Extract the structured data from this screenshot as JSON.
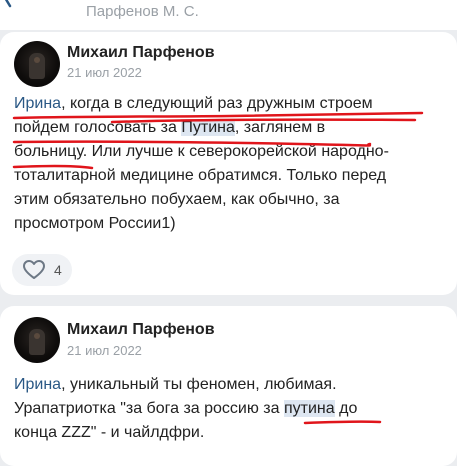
{
  "topbar": {
    "title": "Парфенов М. С."
  },
  "comments": [
    {
      "author": "Михаил Парфенов",
      "date": "21 июл 2022",
      "lines": [
        {
          "mention": "Ирина",
          "t1": ", когда в следующий раз дружным строем"
        },
        {
          "t1": "пойдем голосовать за ",
          "hl": "Путина",
          "t2": ", заглянем в"
        },
        {
          "t1": "больницу. Или лучше к северокорейской народно-"
        },
        {
          "t1": "тоталитарной медицине обратимся. Только перед"
        },
        {
          "t1": "этим обязательно побухаем, как обычно, за"
        },
        {
          "t1": "просмотром России1)"
        }
      ],
      "likes": "4"
    },
    {
      "author": "Михаил Парфенов",
      "date": "21 июл 2022",
      "lines": [
        {
          "mention": "Ирина",
          "t1": ", уникальный ты феномен, любимая."
        },
        {
          "t1": "Урапатриотка \"за бога за россию за ",
          "hl": "путина",
          "t2": " до"
        },
        {
          "t1": "конца ZZZ\" - и чайлдфри."
        }
      ]
    }
  ],
  "colors": {
    "annotation": "#e0151b",
    "mention": "#2a5885"
  }
}
